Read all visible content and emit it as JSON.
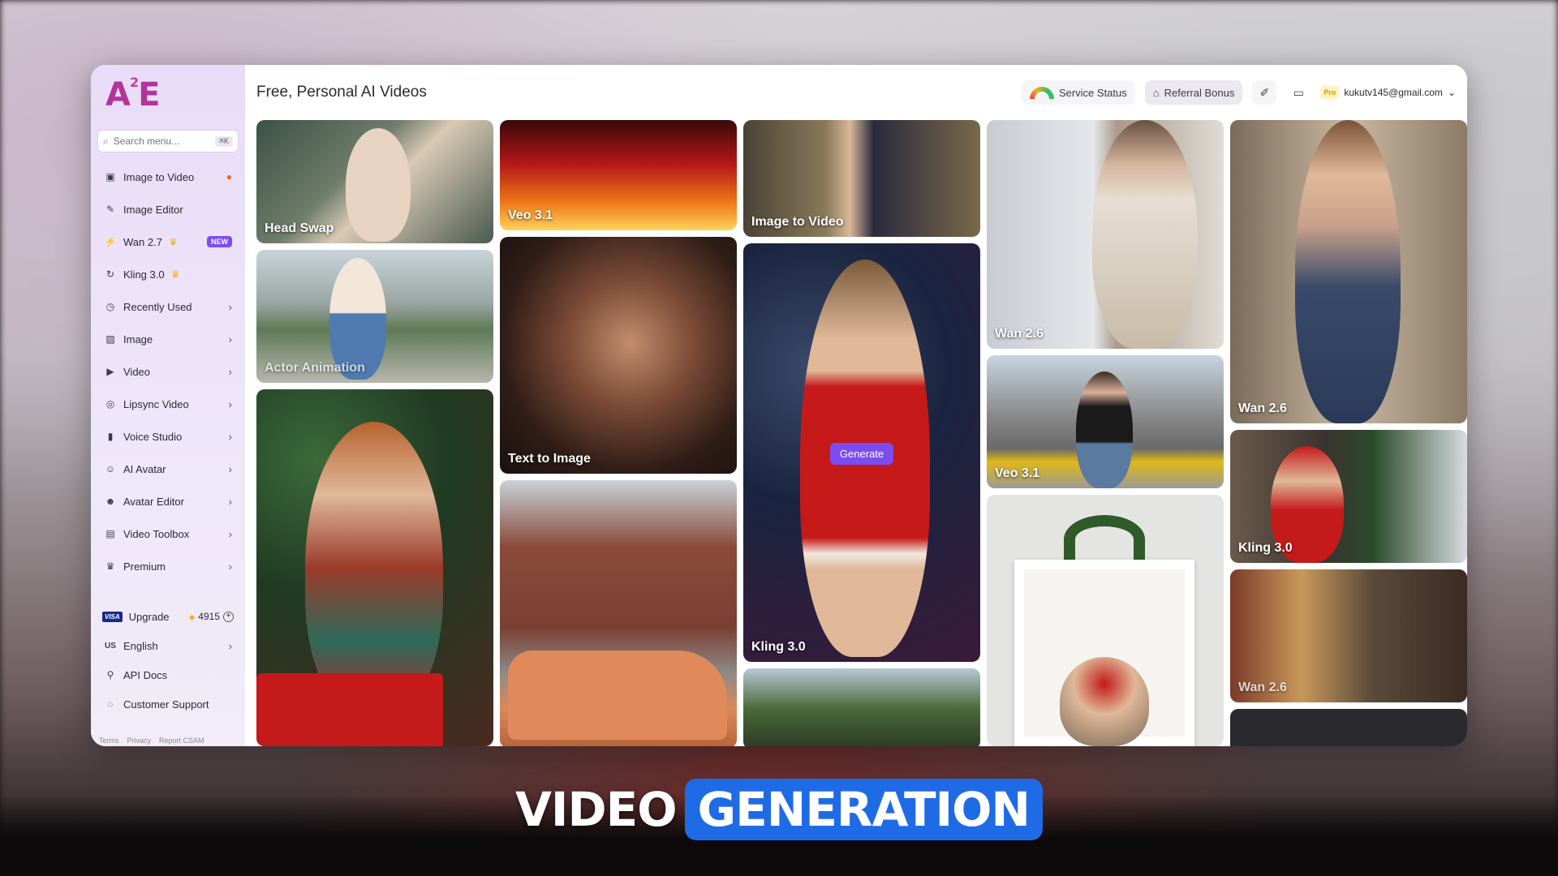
{
  "sidebar": {
    "logo": "A",
    "logo_sup": "2",
    "logo_tail": "E",
    "search_placeholder": "Search menu...",
    "search_shortcut": "⌘K",
    "items": [
      {
        "label": "Image to Video",
        "icon": "image-video-icon",
        "extra": "fire"
      },
      {
        "label": "Image Editor",
        "icon": "edit-icon"
      },
      {
        "label": "Wan 2.7",
        "icon": "wan-icon",
        "extra": "crown",
        "badge": "NEW"
      },
      {
        "label": "Kling 3.0",
        "icon": "kling-icon",
        "extra": "crown"
      },
      {
        "label": "Recently Used",
        "icon": "clock-icon",
        "chevron": true
      },
      {
        "label": "Image",
        "icon": "image-icon",
        "chevron": true
      },
      {
        "label": "Video",
        "icon": "video-icon",
        "chevron": true
      },
      {
        "label": "Lipsync Video",
        "icon": "lipsync-icon",
        "chevron": true
      },
      {
        "label": "Voice Studio",
        "icon": "waveform-icon",
        "chevron": true
      },
      {
        "label": "AI Avatar",
        "icon": "user-icon",
        "chevron": true
      },
      {
        "label": "Avatar Editor",
        "icon": "user-edit-icon",
        "chevron": true
      },
      {
        "label": "Video Toolbox",
        "icon": "toolbox-icon",
        "chevron": true
      },
      {
        "label": "Premium",
        "icon": "crown-icon",
        "chevron": true
      }
    ],
    "upgrade": {
      "card": "VISA",
      "label": "Upgrade",
      "credits": "4915"
    },
    "language": {
      "flag": "US",
      "label": "English"
    },
    "api_docs": "API Docs",
    "support": "Customer Support",
    "footer": [
      "Terms",
      "Privacy",
      "Report CSAM"
    ]
  },
  "header": {
    "title": "Free, Personal AI Videos",
    "service_status": "Service Status",
    "referral": "Referral Bonus",
    "pro": "Pro",
    "email": "kukutv145@gmail.com"
  },
  "gallery": {
    "generate_label": "Generate",
    "cards": {
      "c1a": "Head Swap",
      "c1b": "Actor Animation",
      "c2a": "Veo 3.1",
      "c2b": "Text to Image",
      "c3a": "Image to Video",
      "c3b": "Kling 3.0",
      "c4a": "Wan 2.6",
      "c4b": "Veo 3.1",
      "c5a": "Wan 2.6",
      "c5b": "Kling 3.0",
      "c5c": "Wan 2.6"
    }
  },
  "overlay": {
    "word1": "VIDEO",
    "word2": "GENERATION"
  },
  "colors": {
    "accent": "#7b4cf2",
    "caption_highlight": "#1f6be6",
    "logo": "#b0359a"
  }
}
